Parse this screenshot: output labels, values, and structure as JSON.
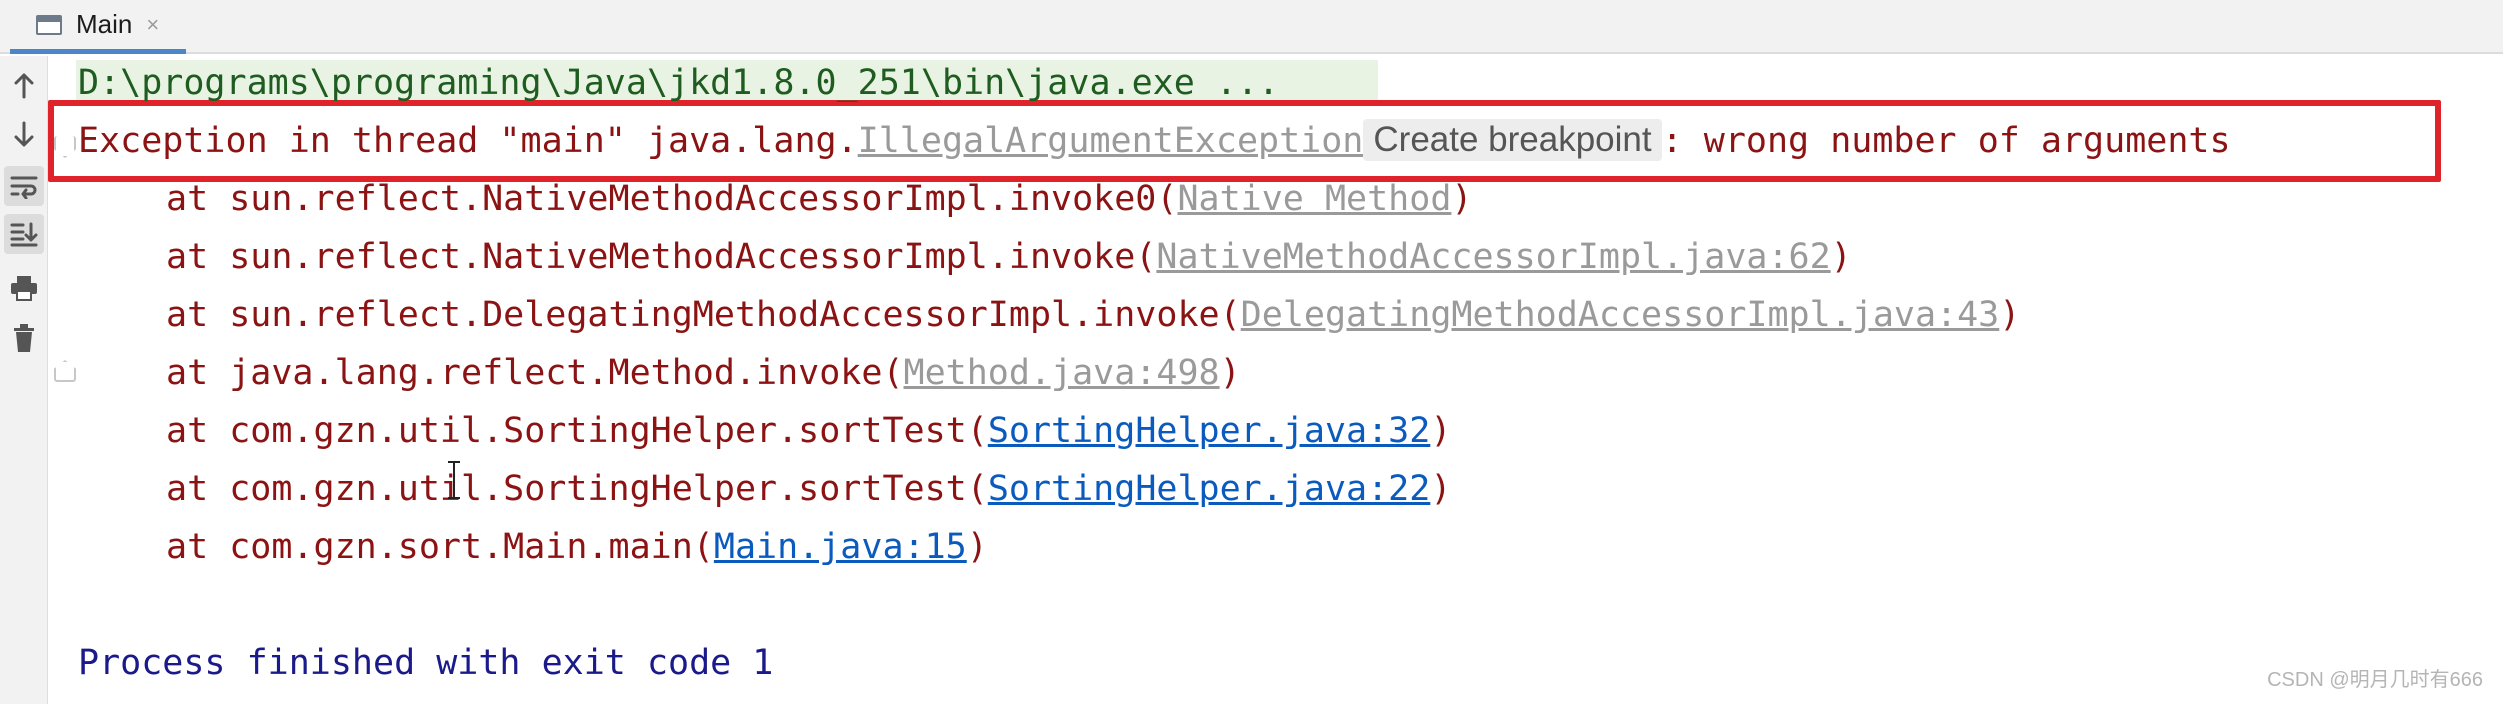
{
  "tab": {
    "label": "Main",
    "close": "×"
  },
  "toolbar": {
    "icons": [
      "up-arrow-icon",
      "down-arrow-icon",
      "soft-wrap-icon",
      "scroll-to-end-icon",
      "print-icon",
      "trash-icon"
    ]
  },
  "console": {
    "command": "D:\\programs\\programing\\Java\\jkd1.8.0_251\\bin\\java.exe ...",
    "exception": {
      "prefix": "Exception in thread \"main\" java.lang.",
      "link": "IllegalArgumentException",
      "breakpoint": "Create breakpoint",
      "suffix": ": wrong number of arguments"
    },
    "stack": [
      {
        "prefix": "at sun.reflect.NativeMethodAccessorImpl.invoke0(",
        "link": "Native Method",
        "suffix": ")",
        "link_style": "gray"
      },
      {
        "prefix": "at sun.reflect.NativeMethodAccessorImpl.invoke(",
        "link": "NativeMethodAccessorImpl.java:62",
        "suffix": ")",
        "link_style": "gray"
      },
      {
        "prefix": "at sun.reflect.DelegatingMethodAccessorImpl.invoke(",
        "link": "DelegatingMethodAccessorImpl.java:43",
        "suffix": ")",
        "link_style": "gray"
      },
      {
        "prefix": "at java.lang.reflect.Method.invoke(",
        "link": "Method.java:498",
        "suffix": ")",
        "link_style": "gray"
      },
      {
        "prefix": "at com.gzn.util.SortingHelper.sortTest(",
        "link": "SortingHelper.java:32",
        "suffix": ")",
        "link_style": "blue"
      },
      {
        "prefix": "at com.gzn.util.SortingHelper.sortTest(",
        "link": "SortingHelper.java:22",
        "suffix": ")",
        "link_style": "blue"
      },
      {
        "prefix": "at com.gzn.sort.Main.main(",
        "link": "Main.java:15",
        "suffix": ")",
        "link_style": "blue"
      }
    ],
    "finish": "Process finished with exit code 1"
  },
  "watermark": "CSDN @明月几时有666",
  "colors": {
    "error_text": "#8b1313",
    "command_text": "#1f5c1f",
    "process_text": "#1a1a8a",
    "link_blue": "#0a5bbd",
    "link_gray": "#9a9a9a",
    "highlight_box": "#e0232a",
    "tab_underline": "#4a86c8"
  }
}
